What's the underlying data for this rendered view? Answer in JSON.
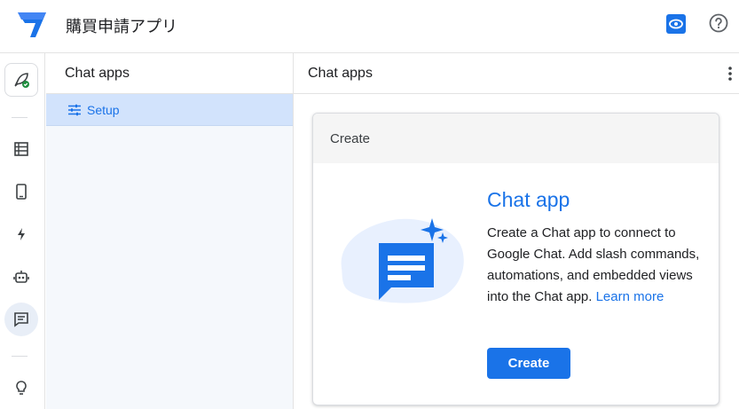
{
  "app": {
    "title": "購買申請アプリ"
  },
  "header": {
    "preview_icon": "eye-icon",
    "help_icon": "help-icon"
  },
  "rail": {
    "items": [
      {
        "icon": "rocket-icon",
        "status": "check"
      },
      {
        "icon": "table-icon"
      },
      {
        "icon": "phone-icon"
      },
      {
        "icon": "bolt-icon"
      },
      {
        "icon": "robot-icon"
      },
      {
        "icon": "chat-icon",
        "active": true
      },
      {
        "icon": "lightbulb-icon"
      }
    ]
  },
  "nav": {
    "title": "Chat apps",
    "items": [
      {
        "label": "Setup",
        "icon": "tune-icon",
        "selected": true
      }
    ]
  },
  "main": {
    "title": "Chat apps",
    "card": {
      "header": "Create",
      "title": "Chat app",
      "description": "Create a Chat app to connect to Google Chat. Add slash commands, automations, and embedded views into the Chat app.",
      "learn_more": "Learn more",
      "button": "Create"
    }
  },
  "colors": {
    "accent": "#1a73e8",
    "nav_selected": "#d2e3fc",
    "success": "#1e8e3e"
  }
}
